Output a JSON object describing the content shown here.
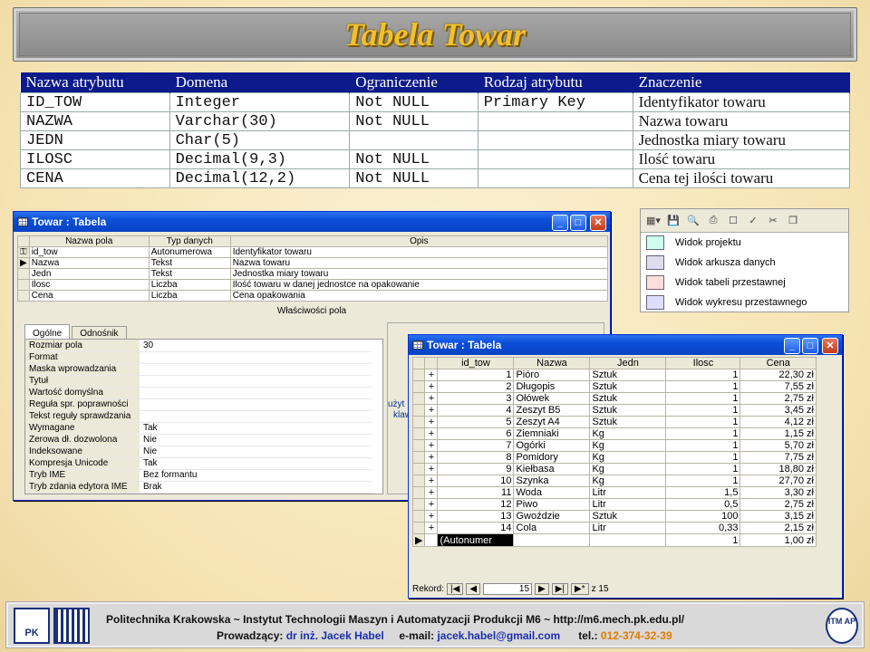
{
  "slide": {
    "title": "Tabela Towar"
  },
  "attr_table": {
    "headers": [
      "Nazwa atrybutu",
      "Domena",
      "Ograniczenie",
      "Rodzaj atrybutu",
      "Znaczenie"
    ],
    "rows": [
      [
        "ID_TOW",
        "Integer",
        "Not NULL",
        "Primary Key",
        "Identyfikator towaru"
      ],
      [
        "NAZWA",
        "Varchar(30)",
        "Not NULL",
        "",
        "Nazwa towaru"
      ],
      [
        "JEDN",
        "Char(5)",
        "",
        "",
        "Jednostka miary towaru"
      ],
      [
        "ILOSC",
        "Decimal(9,3)",
        "Not NULL",
        "",
        "Ilość towaru"
      ],
      [
        "CENA",
        "Decimal(12,2)",
        "Not NULL",
        "",
        "Cena tej ilości towaru"
      ]
    ]
  },
  "design_window": {
    "title": "Towar : Tabela",
    "headers": [
      "Nazwa pola",
      "Typ danych",
      "Opis"
    ],
    "fields": [
      [
        "id_tow",
        "Autonumerowa",
        "Identyfikator towaru"
      ],
      [
        "Nazwa",
        "Tekst",
        "Nazwa towaru"
      ],
      [
        "Jedn",
        "Tekst",
        "Jednostka miary towaru"
      ],
      [
        "Ilosc",
        "Liczba",
        "Ilość towaru w danej jednostce na opakowanie"
      ],
      [
        "Cena",
        "Liczba",
        "Cena opakowania"
      ]
    ],
    "section_label": "Właściwości pola",
    "tabs": [
      "Ogólne",
      "Odnośnik"
    ],
    "properties": [
      [
        "Rozmiar pola",
        "30"
      ],
      [
        "Format",
        ""
      ],
      [
        "Maska wprowadzania",
        ""
      ],
      [
        "Tytuł",
        ""
      ],
      [
        "Wartość domyślna",
        ""
      ],
      [
        "Reguła spr. poprawności",
        ""
      ],
      [
        "Tekst reguły sprawdzania",
        ""
      ],
      [
        "Wymagane",
        "Tak"
      ],
      [
        "Zerowa dł. dozwolona",
        "Nie"
      ],
      [
        "Indeksowane",
        "Nie"
      ],
      [
        "Kompresja Unicode",
        "Tak"
      ],
      [
        "Tryb IME",
        "Bez formantu"
      ],
      [
        "Tryb zdania edytora IME",
        "Brak"
      ]
    ],
    "hint_fragments": [
      "użyt",
      "klaw"
    ]
  },
  "menu": {
    "items": [
      "Widok projektu",
      "Widok arkusza danych",
      "Widok tabeli przestawnej",
      "Widok wykresu przestawnego"
    ]
  },
  "data_window": {
    "title": "Towar : Tabela",
    "headers": [
      "id_tow",
      "Nazwa",
      "Jedn",
      "Ilosc",
      "Cena"
    ],
    "rows": [
      [
        "1",
        "Pióro",
        "Sztuk",
        "1",
        "22,30 zł"
      ],
      [
        "2",
        "Długopis",
        "Sztuk",
        "1",
        "7,55 zł"
      ],
      [
        "3",
        "Ołówek",
        "Sztuk",
        "1",
        "2,75 zł"
      ],
      [
        "4",
        "Zeszyt B5",
        "Sztuk",
        "1",
        "3,45 zł"
      ],
      [
        "5",
        "Zeszyt A4",
        "Sztuk",
        "1",
        "4,12 zł"
      ],
      [
        "6",
        "Ziemniaki",
        "Kg",
        "1",
        "1,15 zł"
      ],
      [
        "7",
        "Ogórki",
        "Kg",
        "1",
        "5,70 zł"
      ],
      [
        "8",
        "Pomidory",
        "Kg",
        "1",
        "7,75 zł"
      ],
      [
        "9",
        "Kiełbasa",
        "Kg",
        "1",
        "18,80 zł"
      ],
      [
        "10",
        "Szynka",
        "Kg",
        "1",
        "27,70 zł"
      ],
      [
        "11",
        "Woda",
        "Litr",
        "1,5",
        "3,30 zł"
      ],
      [
        "12",
        "Piwo",
        "Litr",
        "0,5",
        "2,75 zł"
      ],
      [
        "13",
        "Gwoździe",
        "Sztuk",
        "100",
        "3,15 zł"
      ],
      [
        "14",
        "Cola",
        "Litr",
        "0,33",
        "2,15 zł"
      ]
    ],
    "new_row": [
      "(Autonumer",
      "",
      "",
      "1",
      "1,00 zł"
    ],
    "nav_label": "Rekord:",
    "current_record": "15",
    "of_label": "z 15"
  },
  "footer": {
    "line1": "Politechnika Krakowska   ~   Instytut Technologii Maszyn i Automatyzacji Produkcji M6   ~   http://m6.mech.pk.edu.pl/",
    "lecturer_label": "Prowadzący:",
    "lecturer": "dr inż. Jacek Habel",
    "email_label": "e-mail:",
    "email": "jacek.habel@gmail.com",
    "phone_label": "tel.:",
    "phone": "012-374-32-39",
    "logo_left": "PK",
    "logo_right": "ITM AP"
  },
  "colors": {
    "table_header": "#0d1a8c",
    "title_gold": "#f2c12a",
    "xp_blue": "#0a4ed8"
  }
}
